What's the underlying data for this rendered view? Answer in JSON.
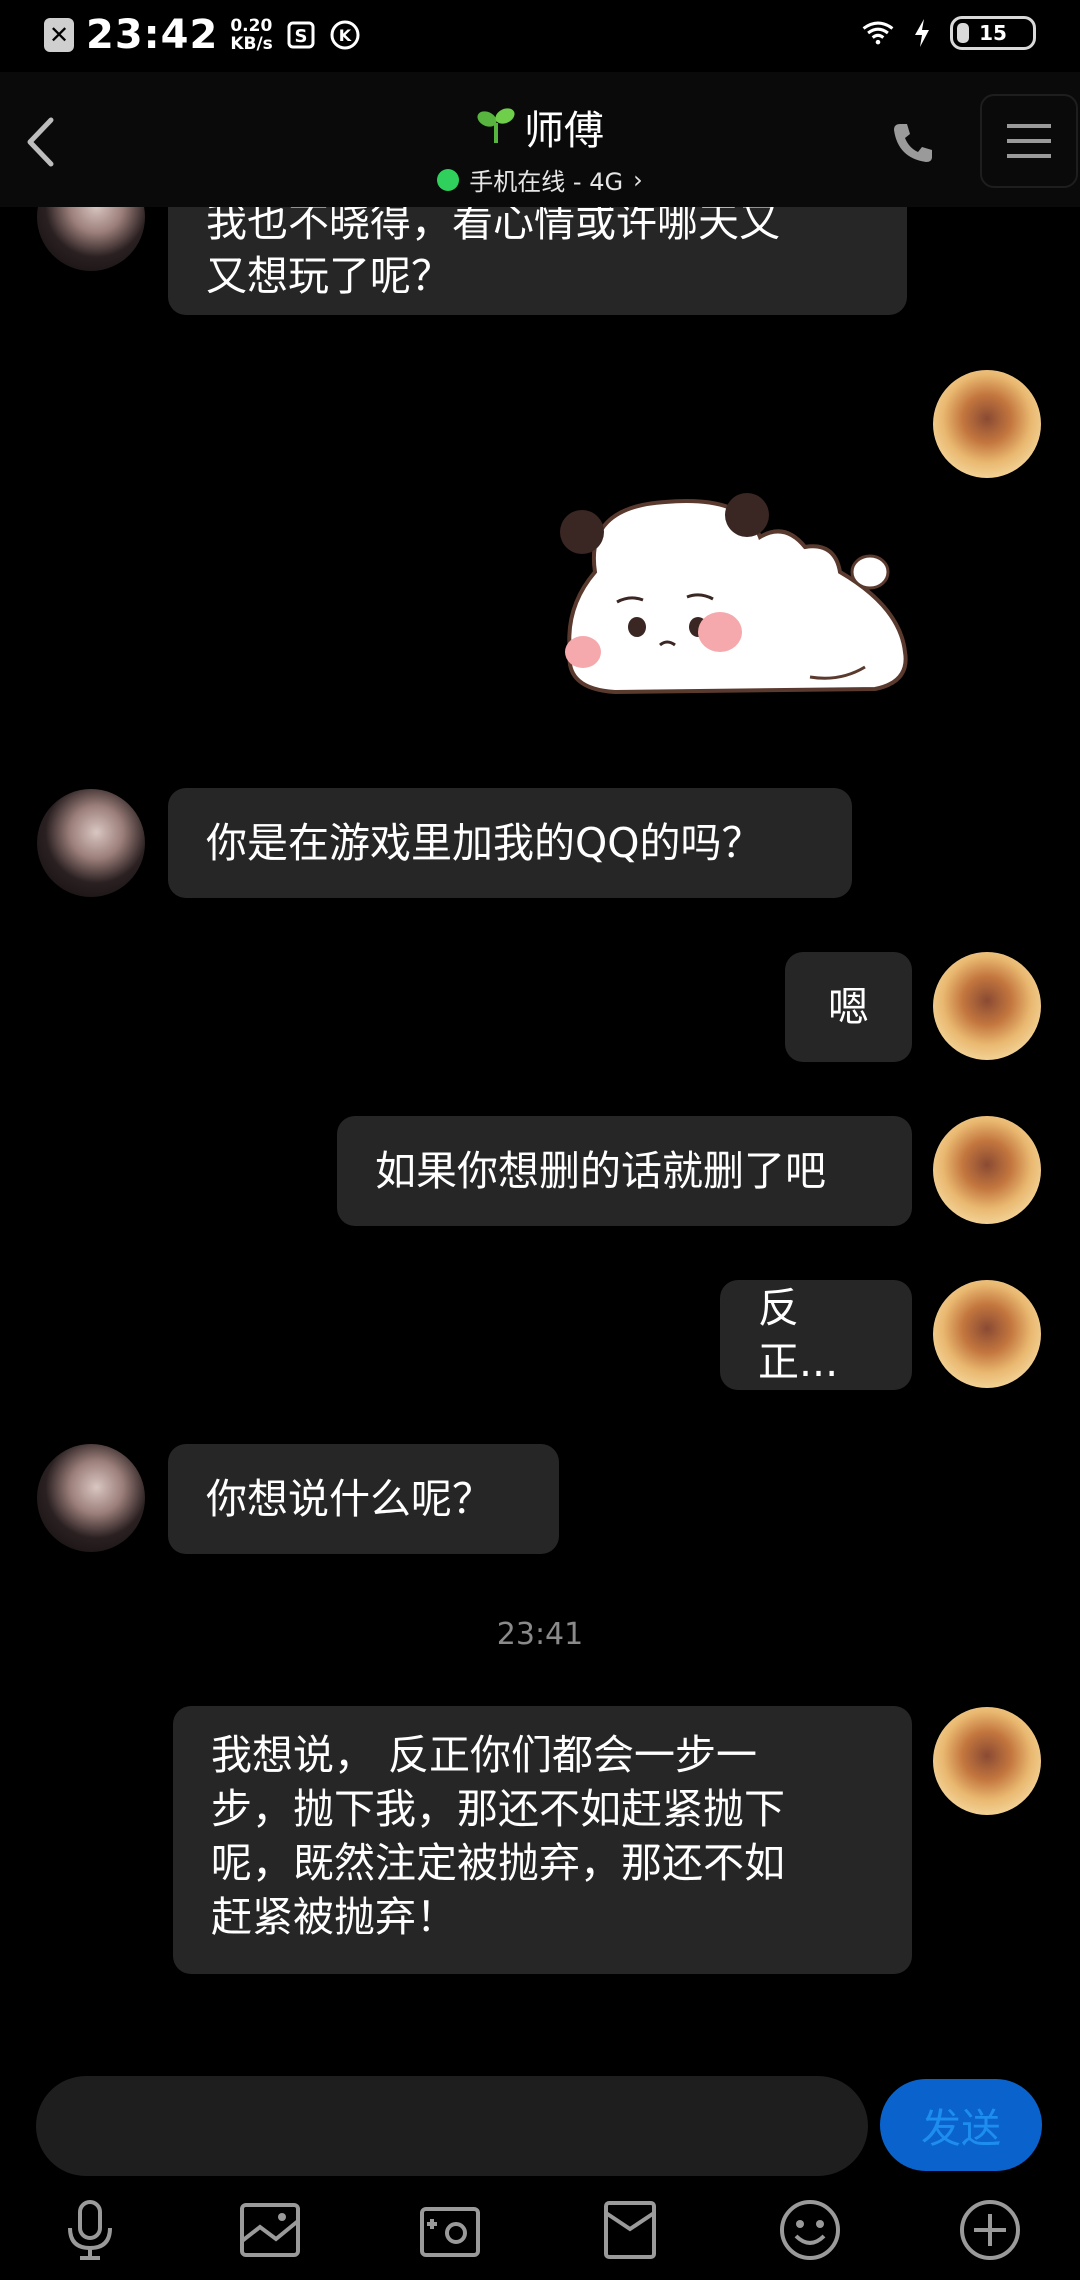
{
  "status_bar": {
    "time": "23:42",
    "speed_value": "0.20",
    "speed_unit": "KB/s",
    "battery": "15"
  },
  "header": {
    "title": "师傅",
    "subtitle": "手机在线 - 4G",
    "subtitle_chevron": "›"
  },
  "messages": [
    {
      "sender": "friend",
      "text": "我也不晓得，看心情或许哪天又\n又想玩了呢？"
    },
    {
      "sender": "me",
      "type": "sticker",
      "sticker": "sleepy-bear-sticker"
    },
    {
      "sender": "friend",
      "text": "你是在游戏里加我的QQ的吗？"
    },
    {
      "sender": "me",
      "text": "嗯"
    },
    {
      "sender": "me",
      "text": "如果你想删的话就删了吧"
    },
    {
      "sender": "me",
      "text": "反正..."
    },
    {
      "sender": "friend",
      "text": "你想说什么呢？"
    },
    {
      "sender": "me",
      "text": "我想说， 反正你们都会一步一\n步，抛下我，那还不如赶紧抛下\n呢，既然注定被抛弃，那还不如\n赶紧被抛弃！"
    }
  ],
  "timestamp": "23:41",
  "composer": {
    "value": "",
    "placeholder": "",
    "send_label": "发送"
  },
  "toolbar": [
    "mic-icon",
    "image-icon",
    "camera-icon",
    "red-packet-icon",
    "emoji-icon",
    "plus-icon"
  ],
  "colors": {
    "background": "#000000",
    "bubble": "#262626",
    "send_button": "#0a63cc",
    "online": "#2fd05b"
  }
}
